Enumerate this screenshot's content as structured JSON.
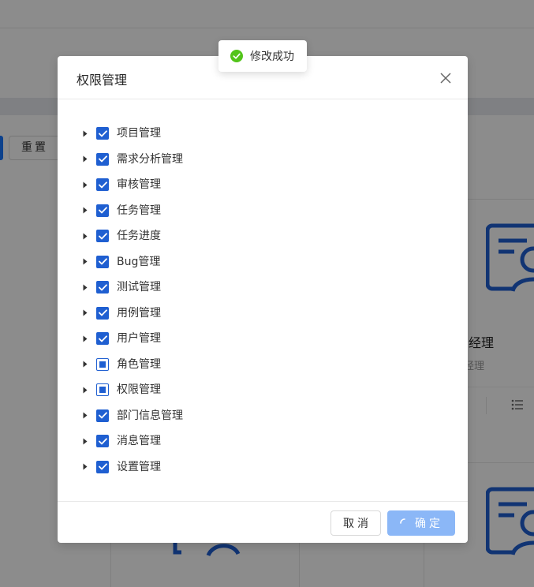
{
  "background": {
    "reset_button_label": "重置",
    "card_name": "经理",
    "card_role": "经理"
  },
  "modal": {
    "title": "权限管理",
    "tree": [
      {
        "label": "项目管理",
        "state": "checked"
      },
      {
        "label": "需求分析管理",
        "state": "checked"
      },
      {
        "label": "审核管理",
        "state": "checked"
      },
      {
        "label": "任务管理",
        "state": "checked"
      },
      {
        "label": "任务进度",
        "state": "checked"
      },
      {
        "label": "Bug管理",
        "state": "checked"
      },
      {
        "label": "测试管理",
        "state": "checked"
      },
      {
        "label": "用例管理",
        "state": "checked"
      },
      {
        "label": "用户管理",
        "state": "checked"
      },
      {
        "label": "角色管理",
        "state": "indeterminate"
      },
      {
        "label": "权限管理",
        "state": "indeterminate"
      },
      {
        "label": "部门信息管理",
        "state": "checked"
      },
      {
        "label": "消息管理",
        "state": "checked"
      },
      {
        "label": "设置管理",
        "state": "checked"
      }
    ],
    "cancel_label": "取消",
    "ok_label": "确定"
  },
  "toast": {
    "message": "修改成功",
    "icon": "check-circle-icon"
  },
  "colors": {
    "primary": "#1f5fd1",
    "primary_loading": "#8bb7f7",
    "success": "#52c41a",
    "text": "#333333",
    "avatar_art": "#1f5fd1"
  },
  "icons": {
    "close": "close-icon",
    "expand": "caret-right-icon",
    "list": "list-icon"
  }
}
